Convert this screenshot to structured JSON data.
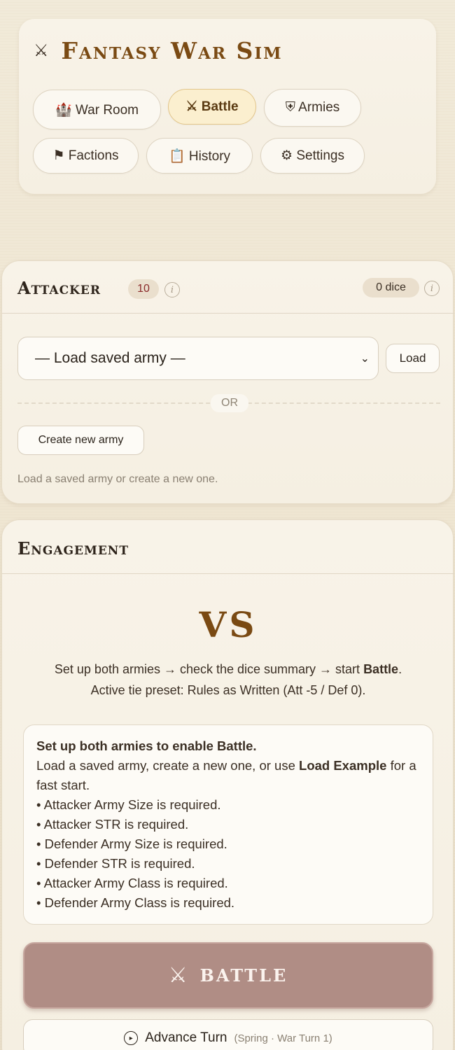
{
  "app": {
    "title": "Fantasy War Sim",
    "icon": "crossed-swords-icon"
  },
  "nav": {
    "war_room": "🏰 War Room",
    "battle": "⚔ Battle",
    "armies": "⛨ Armies",
    "factions": "⚑ Factions",
    "history": "📋 History",
    "settings": "⚙ Settings",
    "active": "battle"
  },
  "attacker": {
    "title": "Attacker",
    "count_badge": "10",
    "dice_badge": "0 dice",
    "select_value": "— Load saved army —",
    "load_label": "Load",
    "or_label": "OR",
    "create_label": "Create new army",
    "hint": "Load a saved army or create a new one."
  },
  "engagement": {
    "title": "Engagement",
    "vs": "VS",
    "desc_line1_pre": "Set up both armies → check the dice summary → start ",
    "desc_line1_bold": "Battle",
    "desc_line1_post": ".",
    "desc_line2": "Active tie preset: Rules as Written (Att -5 / Def 0).",
    "requirements": {
      "heading": "Set up both armies to enable Battle.",
      "intro_pre": "Load a saved army, create a new one, or use ",
      "intro_bold": "Load Example",
      "intro_post": " for a fast start.",
      "items": [
        "• Attacker Army Size is required.",
        "• Attacker STR is required.",
        "• Defender Army Size is required.",
        "• Defender STR is required.",
        "• Attacker Army Class is required.",
        "• Defender Army Class is required."
      ]
    },
    "battle_label": "BATTLE",
    "advance_label": "Advance Turn",
    "advance_sub": "(Spring · War Turn 1)"
  },
  "colors": {
    "accent": "#7a4a13",
    "battle_button": "#b08d85",
    "active_pill": "#fbefcf",
    "card_bg": "#f8f3e8"
  }
}
